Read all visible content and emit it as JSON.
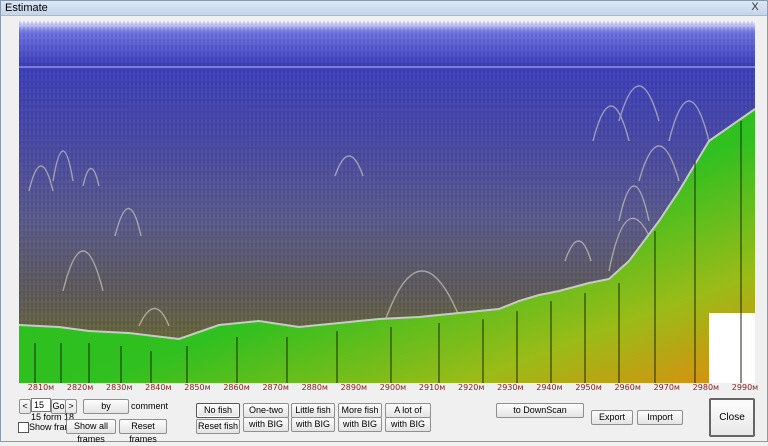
{
  "window": {
    "title": "Estimate",
    "close_label": "X"
  },
  "axis": {
    "unit": "м",
    "ticks": [
      {
        "v": 2810,
        "label": "2810м"
      },
      {
        "v": 2820,
        "label": "2820м"
      },
      {
        "v": 2830,
        "label": "2830м"
      },
      {
        "v": 2840,
        "label": "2840м"
      },
      {
        "v": 2850,
        "label": "2850м"
      },
      {
        "v": 2860,
        "label": "2860м"
      },
      {
        "v": 2870,
        "label": "2870м"
      },
      {
        "v": 2880,
        "label": "2880м"
      },
      {
        "v": 2890,
        "label": "2890м"
      },
      {
        "v": 2900,
        "label": "2900м"
      },
      {
        "v": 2910,
        "label": "2910м"
      },
      {
        "v": 2920,
        "label": "2920м"
      },
      {
        "v": 2930,
        "label": "2930м"
      },
      {
        "v": 2940,
        "label": "2940м"
      },
      {
        "v": 2950,
        "label": "2950м"
      },
      {
        "v": 2960,
        "label": "2960м"
      },
      {
        "v": 2970,
        "label": "2970м"
      },
      {
        "v": 2980,
        "label": "2980м"
      },
      {
        "v": 2990,
        "label": "2990м"
      }
    ]
  },
  "nav": {
    "prev": "<",
    "frame_value": "15",
    "go": "Go",
    "next": ">",
    "frame_info": "15 form 18",
    "by_label": "by",
    "comment_label": "comment",
    "show_frame_label": "Show frame",
    "show_all_frames": "Show all frames",
    "reset_frames": "Reset frames"
  },
  "fish": {
    "no_fish": "No fish",
    "reset_fish": "Reset fish",
    "one_two": "One-two fish",
    "little": "Little fish",
    "more": "More fish",
    "a_lot": "A lot of fish",
    "with_big": "with BIG"
  },
  "actions": {
    "to_downscan": "to DownScan",
    "export": "Export",
    "import": "Import",
    "close": "Close"
  },
  "colors": {
    "water_top": "#3c3fb8",
    "water_mid": "#5a5a9a",
    "water_bottom": "#6a6a30",
    "bottom_green": "#22c21a",
    "bottom_orange": "#e08a10",
    "tick_color": "#8b1a1a"
  }
}
